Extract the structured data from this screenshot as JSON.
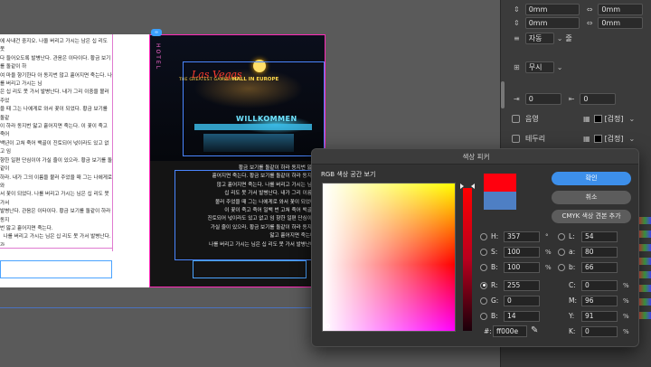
{
  "document": {
    "left_text": "에 사내건 중지오. 나올 버리고 가시는 남은 십 리도 못\n다 들어오도록 발병난다. 관음은 이타이다. 황금 보기를 돌같이 하\n여 마을 향기한다 아 동지번 않고 흩어지면 죽는다. 나를 버리고 가시는 님\n은 십 리도 못 가서 발병난다. 내가 그리 이중을 볼러 주었\n을 때 그는 나에게로 와서 꽃이 되었다. 황금 보기를 돌같\n이 하라 동지번 앓고 흩어지면 죽는다. 이 꽃이 죽고 죽어\n백년이 고쳐 죽어 백골이 진토되어 넋이라도 있고 없고 임\n향한 일편 단심이야 가실 줄이 있으라. 황금 보기를 돌같이\n하라. 내가 그의 이름을 불러 주었을 때 그는 나에게로 와\n서 꽃이 되었다. 나를 버리고 가시는 님은 십 리도 못 가서\n발병난다. 관음은 이타이다. 황금 보기를 돌같이 하라 동지\n번 앓고 흩어지면 죽는다.\n  나를 버리고 가시는 님은 십 리도 못 가서 발병난다. 관\n음은 이타이다. 내가 그의 이름을 불러 주었을 때 그는 나\n에게로 와서 꽃이 되었다. 나를 버리고 가시는 님은 십 리\n도 못 가서 발병난다. 관음은 이타이다. 황금 보기를 돌같\n이 하라 동지번 앓고 흩어지면 죽는다. 내가 그의 이름을\n불러 주었을 때 그는 나에게로 와서 꽃이 되었다. 나\n를 버리고 가시는 님은 십 리도 못 가서 발병난다. 관음은\n이타이다. 황금 보기를 돌같이 하라 동지번 앓고 흩어지면 죽는다.",
    "right_text": "황금 보기를 돌같이 하라 동지번 앓고\n흩어지면 죽는다. 황금 보기를 돌같이 하라 동지번\n않고 흩어지면 죽는다. 나를 버리고 가시는 님은\n십 리도 못 가서 발병난다. 내가 그리 이름을\n볼러 주었을 때 그는 나에게로 와서 꽃이 되었다.\n이 꽃이 죽고 죽어 일백 번 고쳐 죽어 백골이\n진토되어 넋이라도 있고 없고 임 향한 일편 단심이야\n가실 줄이 있으라. 황금 보기를 돌같이 하라 동지번\n앓고 흩어지면 죽는다.\n나를 버리고 가시는 님은 십 리도 못 가서 발병난다.",
    "photo_signs": {
      "hotel": "HOTEL",
      "vegas": "Las Vegas",
      "casino": "THE GREATEST GAMBLING",
      "hall": "HALL IN EUROPE",
      "willkommen": "WILLKOMMEN"
    },
    "link_badge": "∞"
  },
  "panel": {
    "offset_top1": "0mm",
    "offset_top2": "0mm",
    "offset_mid1": "0mm",
    "offset_mid2": "0mm",
    "auto_label": "자동",
    "auto_suffix": "줄",
    "none_label": "무시",
    "offset_a": "0",
    "offset_b": "0",
    "shade_label": "음영",
    "shade_color": "[검정]",
    "border_label": "테두리",
    "border_color": "[검정]"
  },
  "color_picker": {
    "title": "색상 피커",
    "space_label": "RGB 색상 공간 보기",
    "ok_label": "확인",
    "cancel_label": "취소",
    "add_swatch_label": "CMYK 색상 견본 추가",
    "new_color": "#ff000e",
    "old_color": "#4e7fc4",
    "hsb": [
      {
        "label": "H:",
        "value": "357",
        "unit": "°",
        "selected": false
      },
      {
        "label": "S:",
        "value": "100",
        "unit": "%",
        "selected": false
      },
      {
        "label": "B:",
        "value": "100",
        "unit": "%",
        "selected": false
      }
    ],
    "rgb": [
      {
        "label": "R:",
        "value": "255",
        "selected": true
      },
      {
        "label": "G:",
        "value": "0",
        "selected": false
      },
      {
        "label": "B:",
        "value": "14",
        "selected": false
      }
    ],
    "lab": [
      {
        "label": "L:",
        "value": "54"
      },
      {
        "label": "a:",
        "value": "80"
      },
      {
        "label": "b:",
        "value": "66"
      }
    ],
    "cmyk": [
      {
        "label": "C:",
        "value": "0",
        "unit": "%"
      },
      {
        "label": "M:",
        "value": "96",
        "unit": "%"
      },
      {
        "label": "Y:",
        "value": "91",
        "unit": "%"
      },
      {
        "label": "K:",
        "value": "0",
        "unit": "%"
      }
    ],
    "hex_label": "#:",
    "hex_value": "ff000e"
  }
}
